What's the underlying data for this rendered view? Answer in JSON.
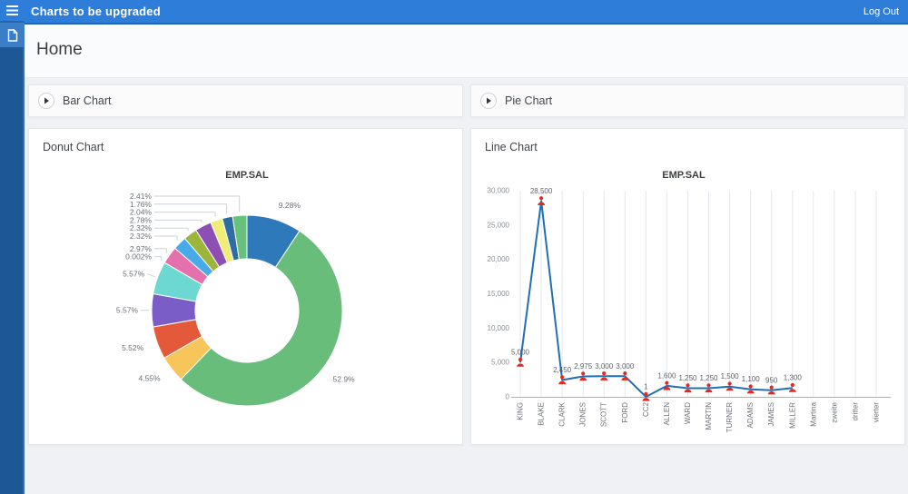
{
  "header": {
    "app_title": "Charts to be upgraded",
    "logout_label": "Log Out"
  },
  "sidebar": {
    "items": [
      {
        "icon": "menu-icon"
      },
      {
        "icon": "page-icon",
        "active": true
      }
    ]
  },
  "page": {
    "title": "Home"
  },
  "panels": [
    {
      "id": "bar",
      "title": "Bar Chart",
      "collapsed": true
    },
    {
      "id": "pie",
      "title": "Pie Chart",
      "collapsed": true
    },
    {
      "id": "donut",
      "title": "Donut Chart",
      "collapsed": false
    },
    {
      "id": "line",
      "title": "Line Chart",
      "collapsed": false
    }
  ],
  "colors": {
    "header_blue": "#2d7dd9",
    "header_border": "#2466ad",
    "rail_navy": "#1d5795",
    "rail_item_active": "#3a7ec7",
    "page_bg": "#eff1f4",
    "panel_bg": "#ffffff",
    "marker_red": "#e8271e",
    "line_blue": "#1f6fb5"
  },
  "chart_data": [
    {
      "type": "pie",
      "variant": "donut",
      "title": "EMP.SAL",
      "legend": false,
      "slices": [
        {
          "pct": 9.28,
          "label": "9.28%",
          "color": "#2e79b9"
        },
        {
          "pct": 52.9,
          "label": "52.9%",
          "color": "#68bd7b"
        },
        {
          "pct": 4.55,
          "label": "4.55%",
          "color": "#f6c65b"
        },
        {
          "pct": 5.52,
          "label": "5.52%",
          "color": "#e4593a"
        },
        {
          "pct": 5.57,
          "label": "5.57%",
          "color": "#7a5dc7"
        },
        {
          "pct": 5.57,
          "label": "5.57%",
          "color": "#6cd8d1"
        },
        {
          "pct": 0.002,
          "label": "0.002%",
          "color": "#b0b7bf"
        },
        {
          "pct": 2.97,
          "label": "2.97%",
          "color": "#e470ae"
        },
        {
          "pct": 2.32,
          "label": "2.32%",
          "color": "#47abe8"
        },
        {
          "pct": 2.32,
          "label": "2.32%",
          "color": "#9cb53b"
        },
        {
          "pct": 2.78,
          "label": "2.78%",
          "color": "#8e4fb4"
        },
        {
          "pct": 2.04,
          "label": "2.04%",
          "color": "#efec77"
        },
        {
          "pct": 1.76,
          "label": "1.76%",
          "color": "#2d6da3"
        },
        {
          "pct": 2.41,
          "label": "2.41%",
          "color": "#67c07b"
        }
      ]
    },
    {
      "type": "line",
      "title": "EMP.SAL",
      "categories": [
        "KING",
        "BLAKE",
        "CLARK",
        "JONES",
        "SCOTT",
        "FORD",
        "CC2",
        "ALLEN",
        "WARD",
        "MARTIN",
        "TURNER",
        "ADAMS",
        "JAMES",
        "MILLER",
        "Martina",
        "zweite",
        "dritter",
        "vierter"
      ],
      "values": [
        5000,
        28500,
        2450,
        2975,
        3000,
        3000,
        1,
        1600,
        1250,
        1250,
        1500,
        1100,
        950,
        1300,
        null,
        null,
        null,
        null
      ],
      "point_labels": [
        "5,000",
        "28,500",
        "2,450",
        "2,975",
        "3,000",
        "3,000",
        "1",
        "1,600",
        "1,250",
        "1,250",
        "1,500",
        "1,100",
        "950",
        "1,300"
      ],
      "ylim": [
        0,
        30000
      ],
      "yticks": [
        "0",
        "5,000",
        "10,000",
        "15,000",
        "20,000",
        "25,000",
        "30,000"
      ],
      "grid": "vertical",
      "legend_position": "none",
      "marker": "person-icon-red"
    }
  ]
}
